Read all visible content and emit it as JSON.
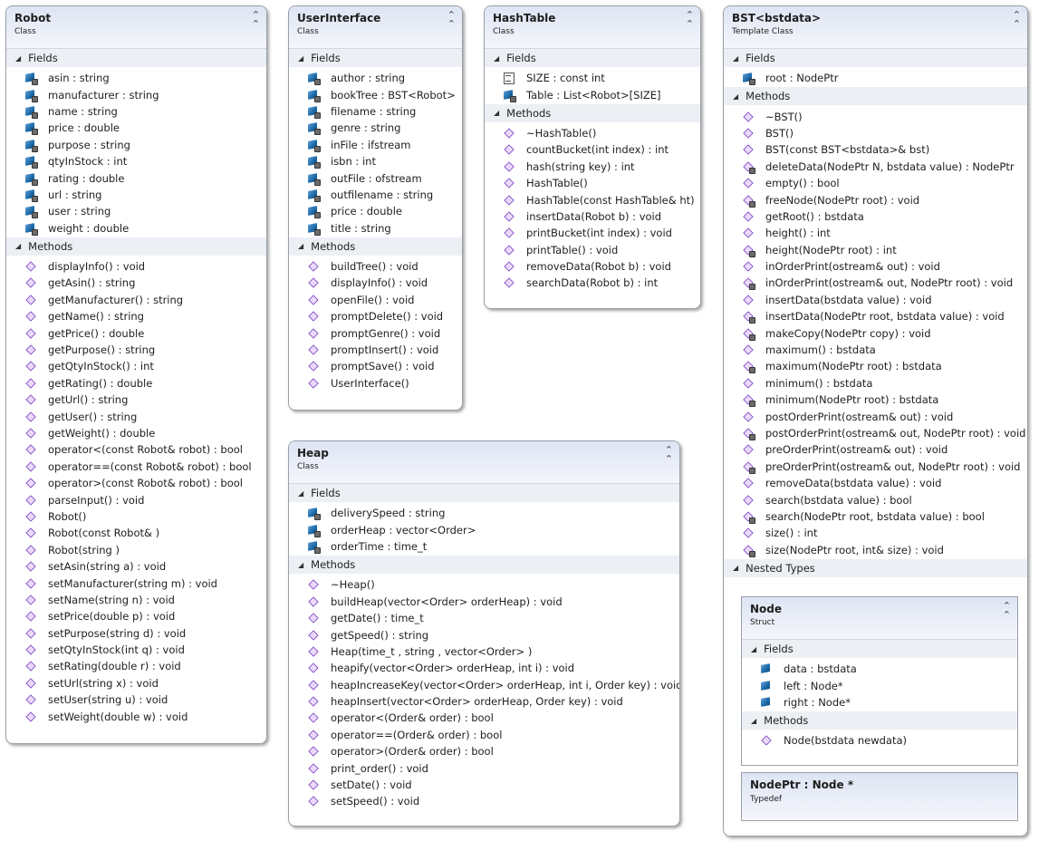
{
  "robot": {
    "title": "Robot",
    "stereotype": "Class",
    "fields_label": "Fields",
    "methods_label": "Methods",
    "fields": [
      "asin : string",
      "manufacturer : string",
      "name : string",
      "price : double",
      "purpose : string",
      "qtyInStock : int",
      "rating : double",
      "url : string",
      "user : string",
      "weight : double"
    ],
    "methods": [
      "displayInfo() : void",
      "getAsin() : string",
      "getManufacturer() : string",
      "getName() : string",
      "getPrice() : double",
      "getPurpose() : string",
      "getQtyInStock() : int",
      "getRating() : double",
      "getUrl() : string",
      "getUser() : string",
      "getWeight() : double",
      "operator<(const Robot& robot) : bool",
      "operator==(const Robot& robot) : bool",
      "operator>(const Robot& robot) : bool",
      "parseInput() : void",
      "Robot()",
      "Robot(const Robot& )",
      "Robot(string )",
      "setAsin(string a) : void",
      "setManufacturer(string m) : void",
      "setName(string n) : void",
      "setPrice(double p) : void",
      "setPurpose(string d) : void",
      "setQtyInStock(int q) : void",
      "setRating(double r) : void",
      "setUrl(string x) : void",
      "setUser(string u) : void",
      "setWeight(double w) : void"
    ]
  },
  "ui": {
    "title": "UserInterface",
    "stereotype": "Class",
    "fields_label": "Fields",
    "methods_label": "Methods",
    "fields": [
      "author : string",
      "bookTree : BST<Robot>",
      "filename : string",
      "genre : string",
      "inFile : ifstream",
      "isbn : int",
      "outFile : ofstream",
      "outfilename : string",
      "price : double",
      "title : string"
    ],
    "methods": [
      "buildTree() : void",
      "displayInfo() : void",
      "openFile() : void",
      "promptDelete() : void",
      "promptGenre() : void",
      "promptInsert() : void",
      "promptSave() : void",
      "UserInterface()"
    ]
  },
  "hash": {
    "title": "HashTable",
    "stereotype": "Class",
    "fields_label": "Fields",
    "methods_label": "Methods",
    "fields": [
      "SIZE : const int",
      "Table : List<Robot>[SIZE]"
    ],
    "methods": [
      "~HashTable()",
      "countBucket(int index) : int",
      "hash(string key) : int",
      "HashTable()",
      "HashTable(const HashTable& ht)",
      "insertData(Robot b) : void",
      "printBucket(int index) : void",
      "printTable() : void",
      "removeData(Robot b) : void",
      "searchData(Robot b) : int"
    ]
  },
  "heap": {
    "title": "Heap",
    "stereotype": "Class",
    "fields_label": "Fields",
    "methods_label": "Methods",
    "fields": [
      "deliverySpeed : string",
      "orderHeap : vector<Order>",
      "orderTime : time_t"
    ],
    "methods": [
      "~Heap()",
      "buildHeap(vector<Order> orderHeap) : void",
      "getDate() : time_t",
      "getSpeed() : string",
      "Heap(time_t , string , vector<Order> )",
      "heapify(vector<Order> orderHeap, int i) : void",
      "heapIncreaseKey(vector<Order> orderHeap, int i, Order key) : void",
      "heapInsert(vector<Order> orderHeap, Order key) : void",
      "operator<(Order& order) : bool",
      "operator==(Order& order) : bool",
      "operator>(Order& order) : bool",
      "print_order() : void",
      "setDate() : void",
      "setSpeed() : void"
    ]
  },
  "bst": {
    "title": "BST<bstdata>",
    "stereotype": "Template Class",
    "fields_label": "Fields",
    "methods_label": "Methods",
    "nested_label": "Nested Types",
    "fields": [
      "root : NodePtr"
    ],
    "methods": [
      "~BST()",
      "BST()",
      "BST(const BST<bstdata>& bst)",
      "deleteData(NodePtr N, bstdata value) : NodePtr",
      "empty() : bool",
      "freeNode(NodePtr root) : void",
      "getRoot() : bstdata",
      "height() : int",
      "height(NodePtr root) : int",
      "inOrderPrint(ostream& out) : void",
      "inOrderPrint(ostream& out, NodePtr root) : void",
      "insertData(bstdata value) : void",
      "insertData(NodePtr root, bstdata value) : void",
      "makeCopy(NodePtr copy) : void",
      "maximum() : bstdata",
      "maximum(NodePtr root) : bstdata",
      "minimum() : bstdata",
      "minimum(NodePtr root) : bstdata",
      "postOrderPrint(ostream& out) : void",
      "postOrderPrint(ostream& out, NodePtr root) : void",
      "preOrderPrint(ostream& out) : void",
      "preOrderPrint(ostream& out, NodePtr root) : void",
      "removeData(bstdata value) : void",
      "search(bstdata value) : bool",
      "search(NodePtr root, bstdata value) : bool",
      "size() : int",
      "size(NodePtr root, int& size) : void"
    ],
    "node": {
      "title": "Node",
      "stereotype": "Struct",
      "fields_label": "Fields",
      "methods_label": "Methods",
      "fields": [
        "data : bstdata",
        "left : Node*",
        "right : Node*"
      ],
      "methods": [
        "Node(bstdata newdata)"
      ]
    },
    "typedef": {
      "title": "NodePtr : Node *",
      "stereotype": "Typedef"
    }
  },
  "icons": {
    "collapse": "double-chevron-up-icon",
    "section_toggle": "triangle-down-icon",
    "field": "field-icon",
    "method": "method-icon",
    "constant": "constant-icon"
  },
  "colors": {
    "header_top": "#dde4f3",
    "section_bg": "#eceff4",
    "field_icon": "#1c6aa8",
    "method_icon": "#7a3fbf"
  }
}
